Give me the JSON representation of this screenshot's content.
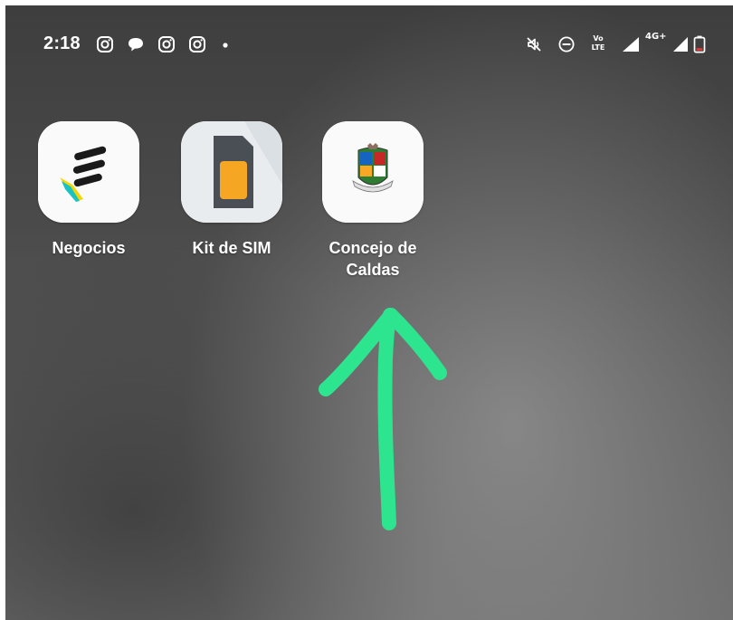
{
  "status_bar": {
    "time": "2:18",
    "left_icons": [
      "instagram-icon",
      "chat-bubble-icon",
      "instagram-icon",
      "instagram-icon",
      "notification-dot-icon"
    ],
    "volte_label_top": "Vo",
    "volte_label_bottom": "LTE",
    "network_label": "4G+",
    "right_icons": [
      "mute-icon",
      "do-not-disturb-icon",
      "volte-icon",
      "signal-icon",
      "signal-icon",
      "battery-icon"
    ]
  },
  "apps": [
    {
      "label": "Negocios",
      "icon": "negocios-app-icon"
    },
    {
      "label": "Kit de SIM",
      "icon": "sim-card-icon"
    },
    {
      "label": "Concejo de\nCaldas",
      "icon": "coat-of-arms-icon"
    }
  ],
  "annotation": {
    "icon": "hand-drawn-arrow-up-icon",
    "color": "#2ee58f"
  },
  "colors": {
    "sim_orange": "#f5a623",
    "sim_body": "#4a4e55",
    "negocios_black": "#1a1a1a",
    "negocios_yellow": "#f5d400",
    "negocios_teal": "#19c3c3"
  }
}
